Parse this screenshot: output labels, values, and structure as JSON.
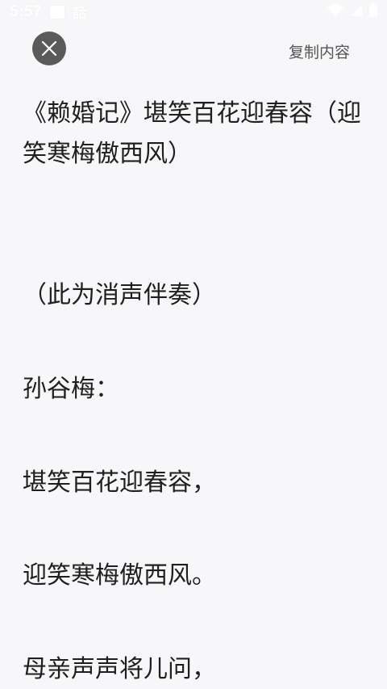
{
  "status_bar": {
    "time": "5:57",
    "app_text": "話"
  },
  "header": {
    "close_icon": "close-icon",
    "copy_label": "复制内容"
  },
  "song": {
    "title": "《赖婚记》堪笑百花迎春容（迎笑寒梅傲西风）"
  },
  "lyrics": [
    "（此为消声伴奏）",
    "孙谷梅：",
    "堪笑百花迎春容，",
    "迎笑寒梅傲西风。",
    "母亲声声将儿问，"
  ],
  "colors": {
    "background": "#f7f7f9",
    "text": "#1f1f1f",
    "close_button": "#5a5a5a",
    "copy_text": "#555555"
  }
}
